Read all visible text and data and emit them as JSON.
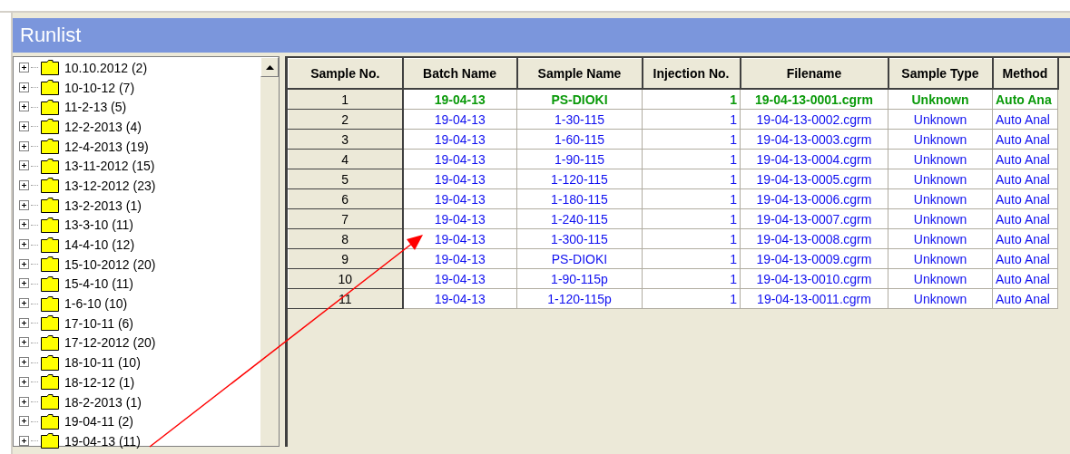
{
  "window": {
    "title": "Runlist"
  },
  "tree": {
    "items": [
      {
        "label": "10.10.2012 (2)",
        "expanded": false
      },
      {
        "label": "10-10-12 (7)",
        "expanded": false
      },
      {
        "label": "11-2-13 (5)",
        "expanded": false
      },
      {
        "label": "12-2-2013 (4)",
        "expanded": false
      },
      {
        "label": "12-4-2013 (19)",
        "expanded": false
      },
      {
        "label": "13-11-2012 (15)",
        "expanded": false
      },
      {
        "label": "13-12-2012 (23)",
        "expanded": false
      },
      {
        "label": "13-2-2013 (1)",
        "expanded": false
      },
      {
        "label": "13-3-10 (11)",
        "expanded": false
      },
      {
        "label": "14-4-10 (12)",
        "expanded": false
      },
      {
        "label": "15-10-2012 (20)",
        "expanded": false
      },
      {
        "label": "15-4-10 (11)",
        "expanded": false
      },
      {
        "label": "1-6-10 (10)",
        "expanded": false
      },
      {
        "label": "17-10-11 (6)",
        "expanded": false
      },
      {
        "label": "17-12-2012 (20)",
        "expanded": false
      },
      {
        "label": "18-10-11 (10)",
        "expanded": false
      },
      {
        "label": "18-12-12 (1)",
        "expanded": false
      },
      {
        "label": "18-2-2013 (1)",
        "expanded": false
      },
      {
        "label": "19-04-11 (2)",
        "expanded": false
      },
      {
        "label": "19-04-13 (11)",
        "expanded": false
      }
    ]
  },
  "table": {
    "columns": [
      "Sample No.",
      "Batch Name",
      "Sample Name",
      "Injection No.",
      "Filename",
      "Sample Type",
      "Method"
    ],
    "rows": [
      {
        "selected": true,
        "cells": [
          "1",
          "19-04-13",
          "PS-DIOKI",
          "1",
          "19-04-13-0001.cgrm",
          "Unknown",
          "Auto Ana"
        ]
      },
      {
        "selected": false,
        "cells": [
          "2",
          "19-04-13",
          "1-30-115",
          "1",
          "19-04-13-0002.cgrm",
          "Unknown",
          "Auto Anal"
        ]
      },
      {
        "selected": false,
        "cells": [
          "3",
          "19-04-13",
          "1-60-115",
          "1",
          "19-04-13-0003.cgrm",
          "Unknown",
          "Auto Anal"
        ]
      },
      {
        "selected": false,
        "cells": [
          "4",
          "19-04-13",
          "1-90-115",
          "1",
          "19-04-13-0004.cgrm",
          "Unknown",
          "Auto Anal"
        ]
      },
      {
        "selected": false,
        "cells": [
          "5",
          "19-04-13",
          "1-120-115",
          "1",
          "19-04-13-0005.cgrm",
          "Unknown",
          "Auto Anal"
        ]
      },
      {
        "selected": false,
        "cells": [
          "6",
          "19-04-13",
          "1-180-115",
          "1",
          "19-04-13-0006.cgrm",
          "Unknown",
          "Auto Anal"
        ]
      },
      {
        "selected": false,
        "cells": [
          "7",
          "19-04-13",
          "1-240-115",
          "1",
          "19-04-13-0007.cgrm",
          "Unknown",
          "Auto Anal"
        ]
      },
      {
        "selected": false,
        "cells": [
          "8",
          "19-04-13",
          "1-300-115",
          "1",
          "19-04-13-0008.cgrm",
          "Unknown",
          "Auto Anal"
        ]
      },
      {
        "selected": false,
        "cells": [
          "9",
          "19-04-13",
          "PS-DIOKI",
          "1",
          "19-04-13-0009.cgrm",
          "Unknown",
          "Auto Anal"
        ]
      },
      {
        "selected": false,
        "cells": [
          "10",
          "19-04-13",
          "1-90-115p",
          "1",
          "19-04-13-0010.cgrm",
          "Unknown",
          "Auto Anal"
        ]
      },
      {
        "selected": false,
        "cells": [
          "11",
          "19-04-13",
          "1-120-115p",
          "1",
          "19-04-13-0011.cgrm",
          "Unknown",
          "Auto Anal"
        ]
      }
    ]
  }
}
